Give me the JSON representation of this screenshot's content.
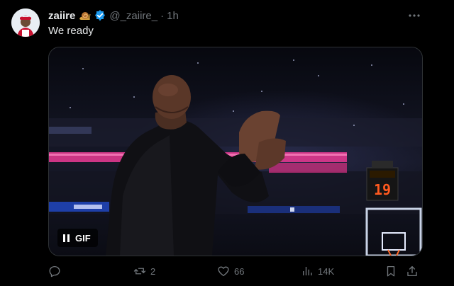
{
  "post": {
    "display_name": "zaiire",
    "handle": "@_zaiire_",
    "separator": "·",
    "time": "1h",
    "text": "We ready",
    "media": {
      "type_label": "GIF",
      "scoreboard_digits": "19"
    },
    "actions": {
      "replies": "",
      "reposts": "2",
      "likes": "66",
      "views": "14K"
    }
  },
  "colors": {
    "background": "#000000",
    "text_primary": "#e7e9ea",
    "text_secondary": "#71767b",
    "verified_blue": "#1d9bf0",
    "border": "#2f3336"
  },
  "icons": [
    "avatar",
    "snail-emoji-icon",
    "verified-badge-icon",
    "more-options-icon",
    "pause-icon",
    "reply-icon",
    "repost-icon",
    "like-icon",
    "views-icon",
    "bookmark-icon",
    "share-icon"
  ]
}
